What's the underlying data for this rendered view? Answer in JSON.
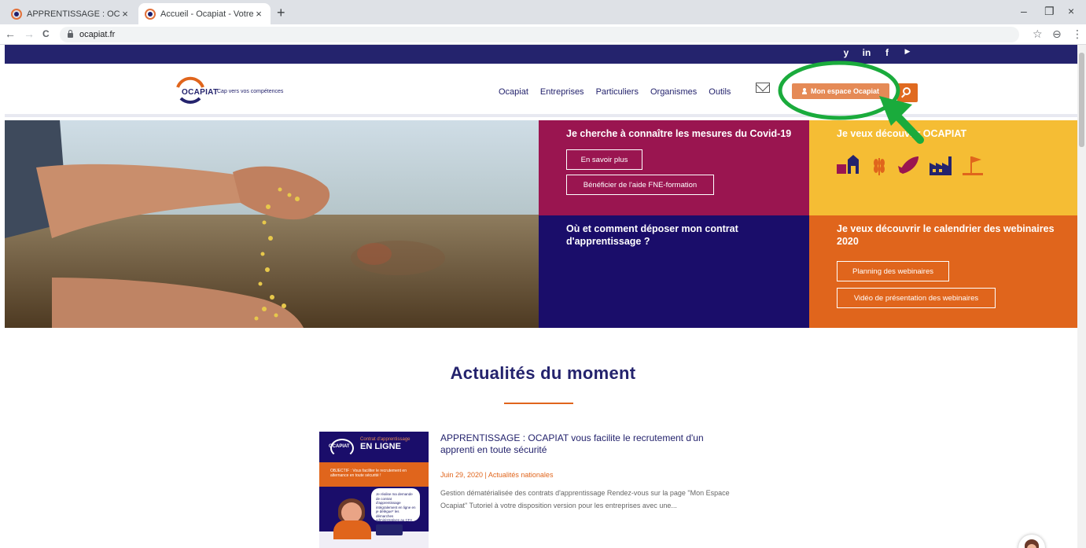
{
  "browser": {
    "tabs": [
      {
        "title": "APPRENTISSAGE : OCAPIAT vous",
        "active": false
      },
      {
        "title": "Accueil - Ocapiat - Votre opérate",
        "active": true
      }
    ],
    "new_tab": "+",
    "close": "×",
    "url": "ocapiat.fr",
    "minimize": "–",
    "restore": "❐",
    "window_close": "×",
    "back": "←",
    "forward": "→",
    "reload": "C",
    "star": "☆",
    "profile": "⊖",
    "menu": "⋮"
  },
  "social": [
    "y",
    "in",
    "f",
    "▶"
  ],
  "header": {
    "logo_word": "OCAPIAT",
    "tagline": "Cap vers vos compétences",
    "nav": [
      "Ocapiat",
      "Entreprises",
      "Particuliers",
      "Organismes",
      "Outils"
    ],
    "espace_label": "Mon espace Ocapiat"
  },
  "hero": {
    "covid": {
      "title": "Je cherche à connaître les mesures du Covid-19",
      "button1": "En savoir plus",
      "button2": "Bénéficier de l'aide FNE-formation"
    },
    "decouvrir": {
      "title": "Je veux découvrir OCAPIAT",
      "icons": [
        "farm-icon",
        "wheat-icon",
        "fish-icon",
        "factory-icon",
        "flag-icon"
      ]
    },
    "contrat": {
      "title": "Où et comment déposer mon contrat d'apprentissage ?"
    },
    "webinaires": {
      "title": "Je veux découvrir le calendrier des webinaires 2020",
      "button1": "Planning des webinaires",
      "button2": "Vidéo de présentation des webinaires"
    }
  },
  "news": {
    "section_title": "Actualités du moment",
    "article": {
      "title": "APPRENTISSAGE : OCAPIAT vous facilite le recrutement d'un apprenti en toute sécurité",
      "meta": "Juin 29, 2020 | Actualités nationales",
      "excerpt": "Gestion dématérialisée des contrats d'apprentissage    Rendez-vous sur la page \"Mon Espace Ocapiat\"    Tutoriel à votre disposition version pour les entreprises avec une...",
      "thumb": {
        "logo": "OCAPIAT",
        "kicker": "Contrat d'apprentissage",
        "headline": "EN LIGNE",
        "band": "OBJECTIF : Vous faciliter le recrutement en alternance en toute sécurité !",
        "bubble": "Je réalise ma demande de contrat d'apprentissage intégralement en ligne en je délègue* les démarches administratives au CFA"
      }
    }
  },
  "colors": {
    "navy": "#24236d",
    "orange": "#e0651c",
    "covid_tile": "#9a1550",
    "yellow_tile": "#f5bd34",
    "contrat_tile": "#1a0d6a",
    "annotation": "#1aab3c"
  }
}
